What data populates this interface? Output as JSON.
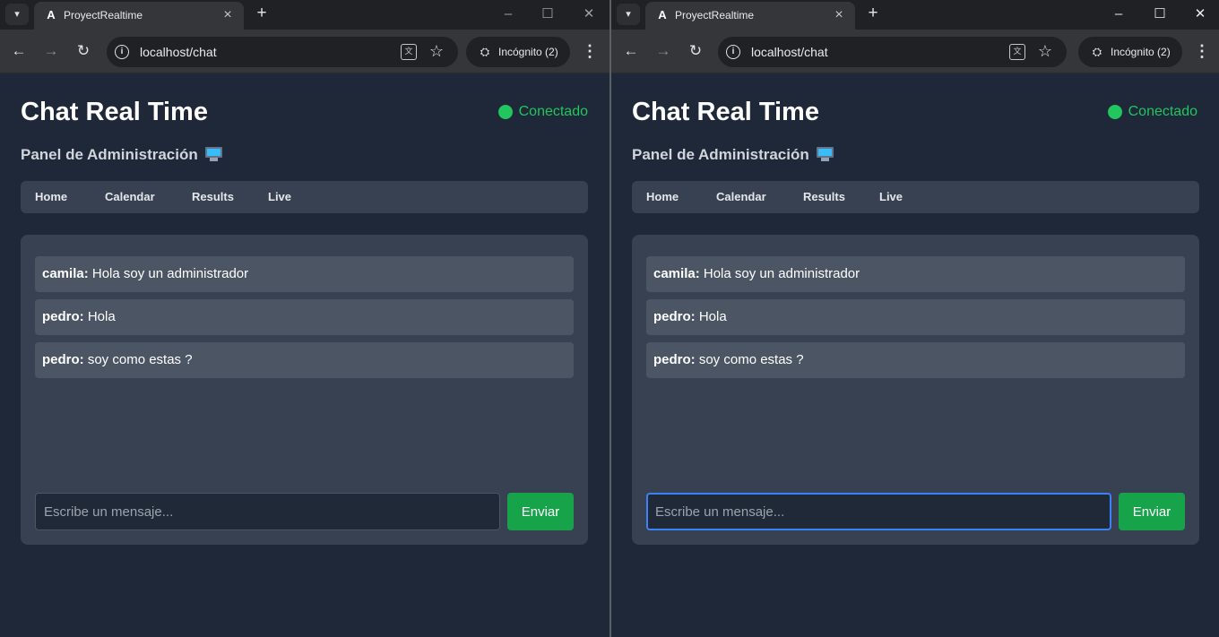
{
  "browser": {
    "tab_title": "ProyectRealtime",
    "url": "localhost/chat",
    "incognito_label": "Incógnito (2)"
  },
  "icons": {
    "tab_search": "chevron-down-icon",
    "favicon": "angular-logo-icon",
    "tab_close": "close-icon",
    "new_tab": "plus-icon",
    "back": "arrow-left-icon",
    "forward": "arrow-right-icon",
    "reload": "reload-icon",
    "site_info": "info-icon",
    "translate": "translate-icon",
    "bookmark": "star-icon",
    "incognito": "incognito-icon",
    "menu": "kebab-menu-icon",
    "minimize": "minimize-icon",
    "maximize": "maximize-icon",
    "close_window": "close-icon"
  },
  "app": {
    "title": "Chat Real Time",
    "status": "Conectado",
    "subtitle": "Panel de Administración",
    "nav": [
      "Home",
      "Calendar",
      "Results",
      "Live"
    ],
    "messages": [
      {
        "user": "camila:",
        "text": "Hola soy un administrador"
      },
      {
        "user": "pedro:",
        "text": "Hola"
      },
      {
        "user": "pedro:",
        "text": "soy como estas ?"
      }
    ],
    "input_placeholder": "Escribe un mensaje...",
    "send_label": "Enviar"
  },
  "colors": {
    "page_bg": "#1f2838",
    "card_bg": "#374151",
    "message_bg": "#4b5563",
    "status_green": "#22c55e",
    "send_button": "#16a34a",
    "focus_ring": "#3b82f6"
  }
}
